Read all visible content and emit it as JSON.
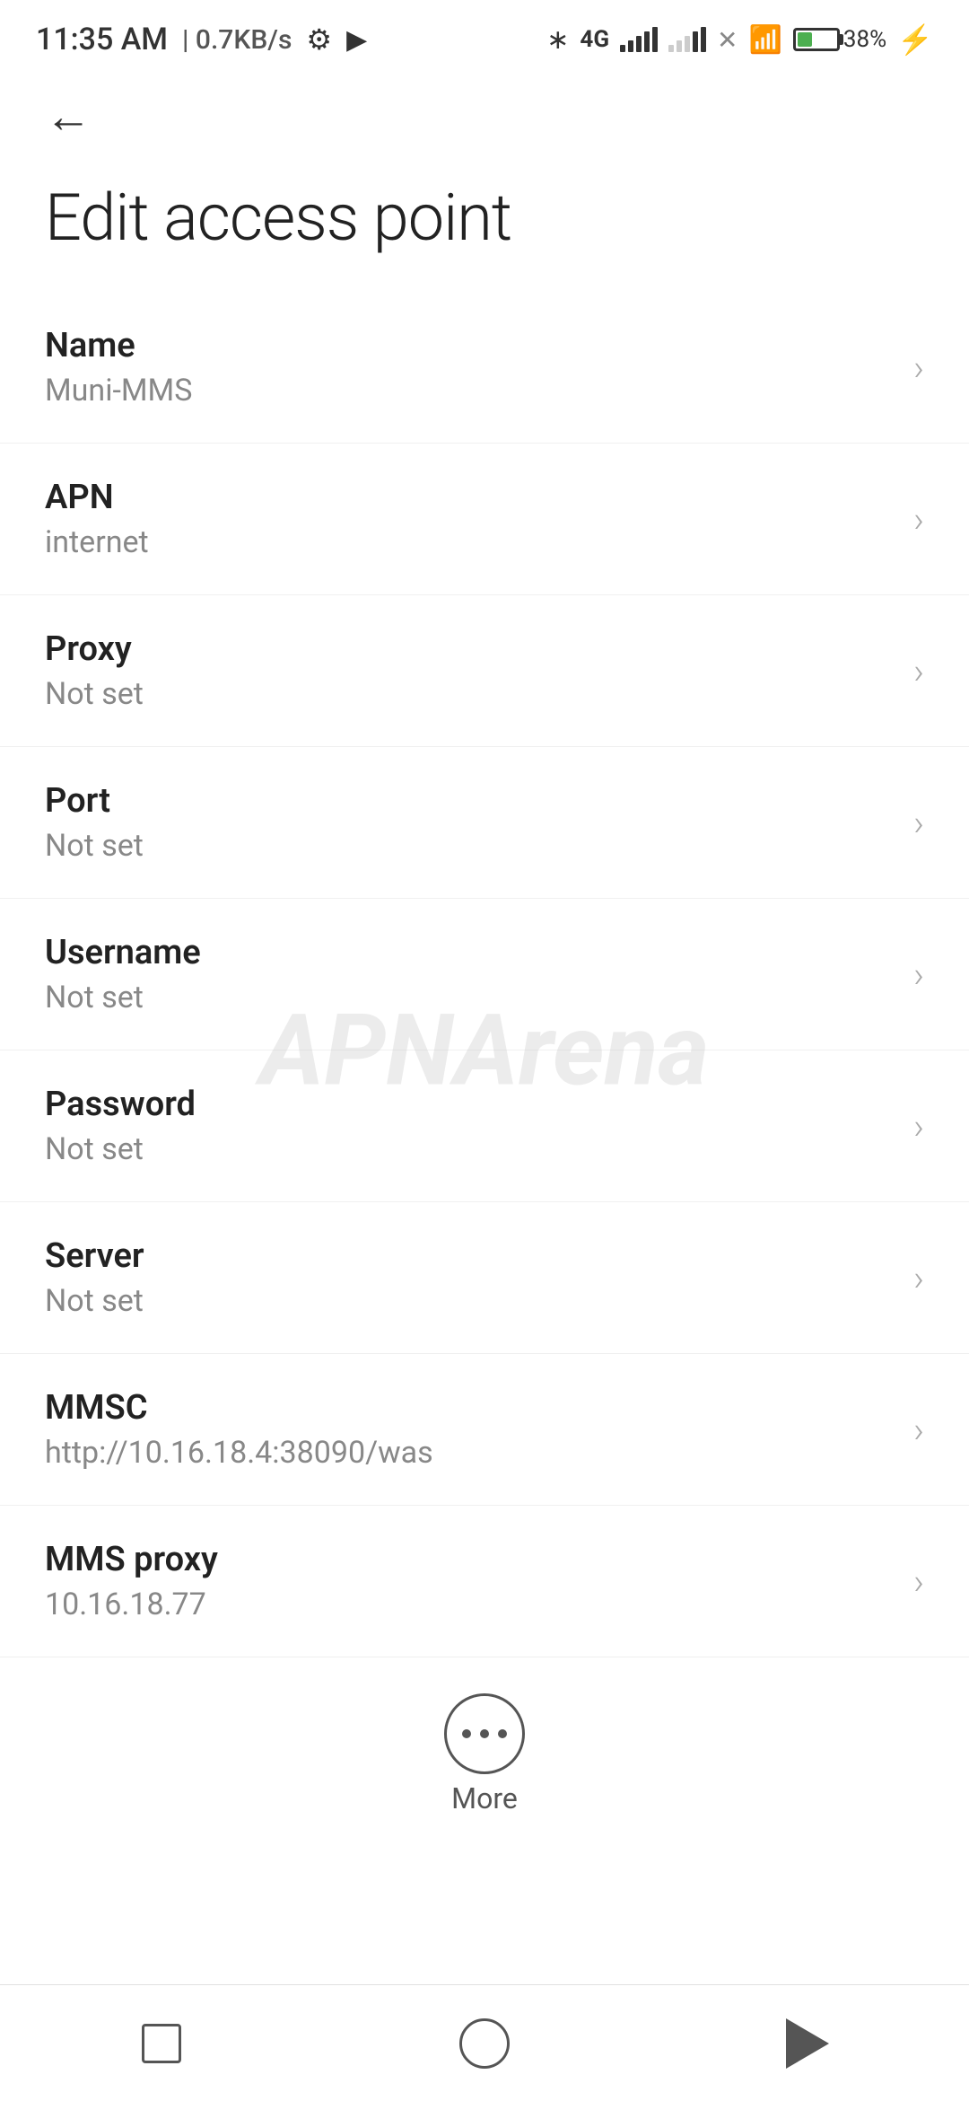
{
  "statusBar": {
    "time": "11:35 AM",
    "speed": "0.7KB/s",
    "battery": "38"
  },
  "nav": {
    "backLabel": "←"
  },
  "pageTitle": "Edit access point",
  "watermark": "APNArena",
  "settings": [
    {
      "label": "Name",
      "value": "Muni-MMS"
    },
    {
      "label": "APN",
      "value": "internet"
    },
    {
      "label": "Proxy",
      "value": "Not set"
    },
    {
      "label": "Port",
      "value": "Not set"
    },
    {
      "label": "Username",
      "value": "Not set"
    },
    {
      "label": "Password",
      "value": "Not set"
    },
    {
      "label": "Server",
      "value": "Not set"
    },
    {
      "label": "MMSC",
      "value": "http://10.16.18.4:38090/was"
    },
    {
      "label": "MMS proxy",
      "value": "10.16.18.77"
    }
  ],
  "more": {
    "label": "More"
  }
}
